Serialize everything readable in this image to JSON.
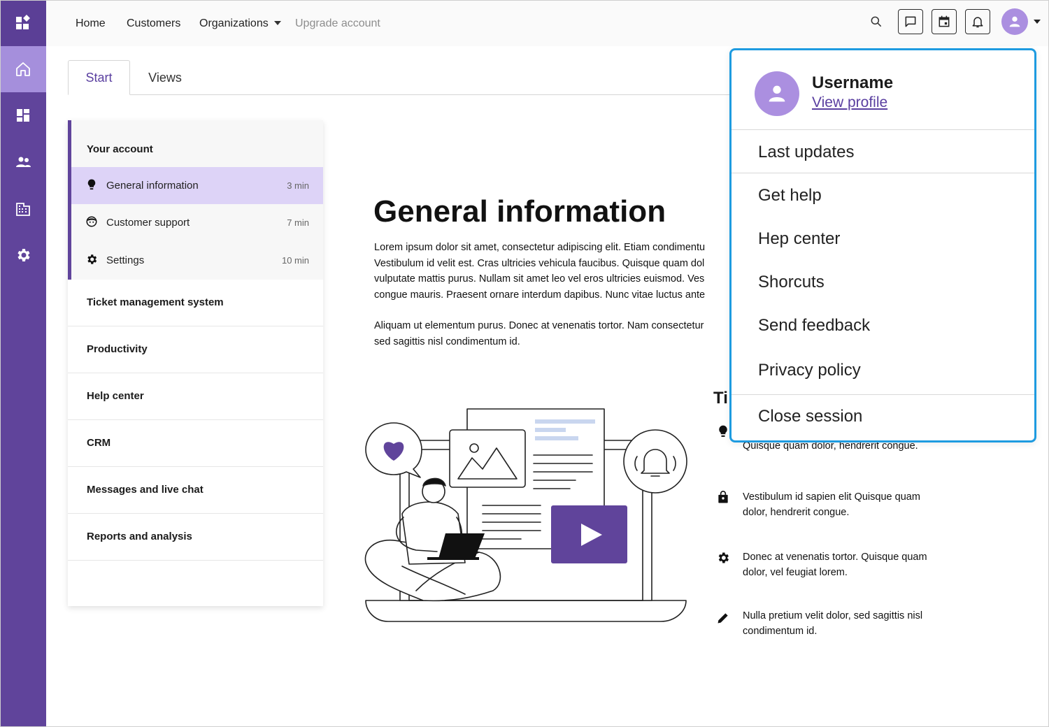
{
  "rail": {
    "items": [
      {
        "name": "logo",
        "icon": "apps-logo-icon"
      },
      {
        "name": "home",
        "icon": "home-icon",
        "active": true
      },
      {
        "name": "dashboard",
        "icon": "dashboard-icon"
      },
      {
        "name": "people",
        "icon": "people-icon"
      },
      {
        "name": "organizations",
        "icon": "building-icon"
      },
      {
        "name": "settings",
        "icon": "gear-icon"
      }
    ],
    "colors": {
      "background": "#60449b",
      "active": "#a58fdc"
    }
  },
  "topbar": {
    "nav": {
      "home": "Home",
      "customers": "Customers",
      "organizations": "Organizations",
      "upgrade": "Upgrade account"
    },
    "icons": [
      "search-icon",
      "chat-icon",
      "calendar-icon",
      "bell-icon",
      "avatar-icon"
    ]
  },
  "tabs": {
    "start": "Start",
    "views": "Views"
  },
  "panel": {
    "group_title": "Your account",
    "subitems": [
      {
        "label": "General information",
        "duration": "3 min",
        "icon": "lightbulb-icon",
        "selected": true
      },
      {
        "label": "Customer support",
        "duration": "7 min",
        "icon": "support-face-icon"
      },
      {
        "label": "Settings",
        "duration": "10 min",
        "icon": "gear-icon"
      }
    ],
    "sections": [
      "Ticket management system",
      "Productivity",
      "Help center",
      "CRM",
      "Messages and live chat",
      "Reports and analysis"
    ]
  },
  "main": {
    "title": "General information",
    "para1": [
      "Lorem ipsum dolor sit amet, consectetur adipiscing elit. Etiam condimentu",
      "Vestibulum id velit est. Cras ultricies vehicula faucibus. Quisque quam dol",
      "vulputate mattis purus. Nullam sit amet leo vel eros ultricies euismod. Ves",
      "congue mauris. Praesent ornare interdum dapibus. Nunc vitae luctus ante"
    ],
    "para2": [
      "Aliquam ut elementum purus. Donec at venenatis tortor. Nam consectetur",
      "sed sagittis nisl condimentum id."
    ],
    "tips_title": "Ti",
    "tips": [
      {
        "icon": "lightbulb-icon",
        "text": "Quisque quam dolor, hendrerit congue."
      },
      {
        "icon": "bag-icon",
        "text": "Vestibulum id sapien elit Quisque quam dolor, hendrerit congue."
      },
      {
        "icon": "gear-icon",
        "text": "Donec at venenatis tortor. Quisque quam dolor, vel feugiat lorem."
      },
      {
        "icon": "pencil-icon",
        "text": "Nulla pretium velit dolor, sed sagittis nisl condimentum id."
      }
    ]
  },
  "dropdown": {
    "username": "Username",
    "view_profile": "View profile",
    "items": {
      "last_updates": "Last updates",
      "get_help": "Get help",
      "help_center": "Hep center",
      "shortcuts": "Shorcuts",
      "send_feedback": "Send feedback",
      "privacy_policy": "Privacy policy",
      "close_session": "Close session"
    },
    "border_color": "#1e9be0"
  }
}
